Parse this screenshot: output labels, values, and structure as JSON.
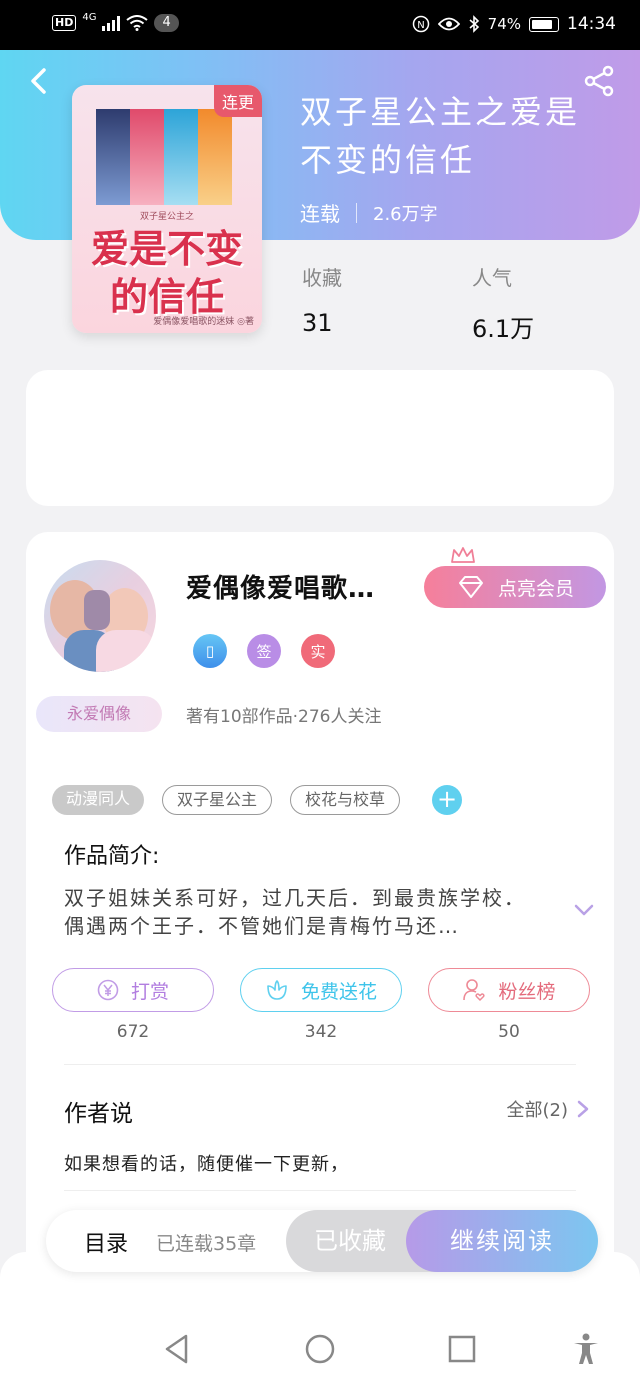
{
  "status_bar": {
    "network": "HD",
    "signal_type": "4G",
    "notification_count": "4",
    "battery": "74%",
    "time": "14:34"
  },
  "header": {
    "back_icon": "back-arrow-icon",
    "share_icon": "share-icon"
  },
  "book": {
    "cover_badge": "连更",
    "cover_title": "爱是不变的信任",
    "cover_subtitle": "双子星公主之",
    "cover_author": "爱偶像爱唱歌的迷妹 ◎著",
    "title": "双子星公主之爱是不变的信任",
    "status": "连载",
    "word_count": "2.6万字",
    "favorites_label": "收藏",
    "favorites_value": "31",
    "popularity_label": "人气",
    "popularity_value": "6.1万"
  },
  "author": {
    "name": "爱偶像爱唱歌…",
    "vip_button": "点亮会员",
    "badge_phone": "▯",
    "badge_sign": "签",
    "badge_real": "实",
    "fan_badge": "永爱偶像",
    "stats": "著有10部作品·276人关注"
  },
  "tags": [
    "动漫同人",
    "双子星公主",
    "校花与校草"
  ],
  "tags_add": "+",
  "intro": {
    "heading": "作品简介:",
    "text": "双子姐妹关系可好，过几天后．到最贵族学校．偶遇两个王子．不管她们是青梅竹马还…"
  },
  "actions": [
    {
      "label": "打赏",
      "icon": "yen-coin-icon",
      "count": "672"
    },
    {
      "label": "免费送花",
      "icon": "flower-icon",
      "count": "342"
    },
    {
      "label": "粉丝榜",
      "icon": "person-heart-icon",
      "count": "50"
    }
  ],
  "author_says": {
    "heading": "作者说",
    "all_label": "全部(2)",
    "text": "如果想看的话，随便催一下更新，"
  },
  "bottom_bar": {
    "toc_label": "目录",
    "toc_status": "已连载35章",
    "collected_label": "已收藏",
    "read_label": "继续阅读"
  },
  "colors": {
    "header_gradient_start": "#5fd6f2",
    "header_gradient_end": "#c09be8",
    "vip_gradient_start": "#f67f9a",
    "vip_gradient_end": "#c297e3",
    "accent_cyan": "#5fd0ef",
    "accent_purple": "#c19ce6",
    "accent_pink": "#ee8a96"
  }
}
